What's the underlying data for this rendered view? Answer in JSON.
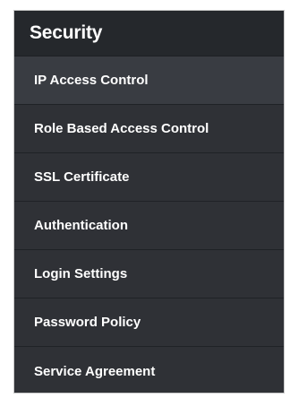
{
  "header": {
    "title": "Security"
  },
  "menu": {
    "items": [
      {
        "label": "IP Access Control"
      },
      {
        "label": "Role Based Access Control"
      },
      {
        "label": "SSL Certificate"
      },
      {
        "label": "Authentication"
      },
      {
        "label": "Login Settings"
      },
      {
        "label": "Password Policy"
      },
      {
        "label": "Service Agreement"
      }
    ]
  },
  "colors": {
    "panel_background": "#2f3136",
    "header_background": "#25282c",
    "active_item_background": "#393c42",
    "text": "#ffffff"
  }
}
